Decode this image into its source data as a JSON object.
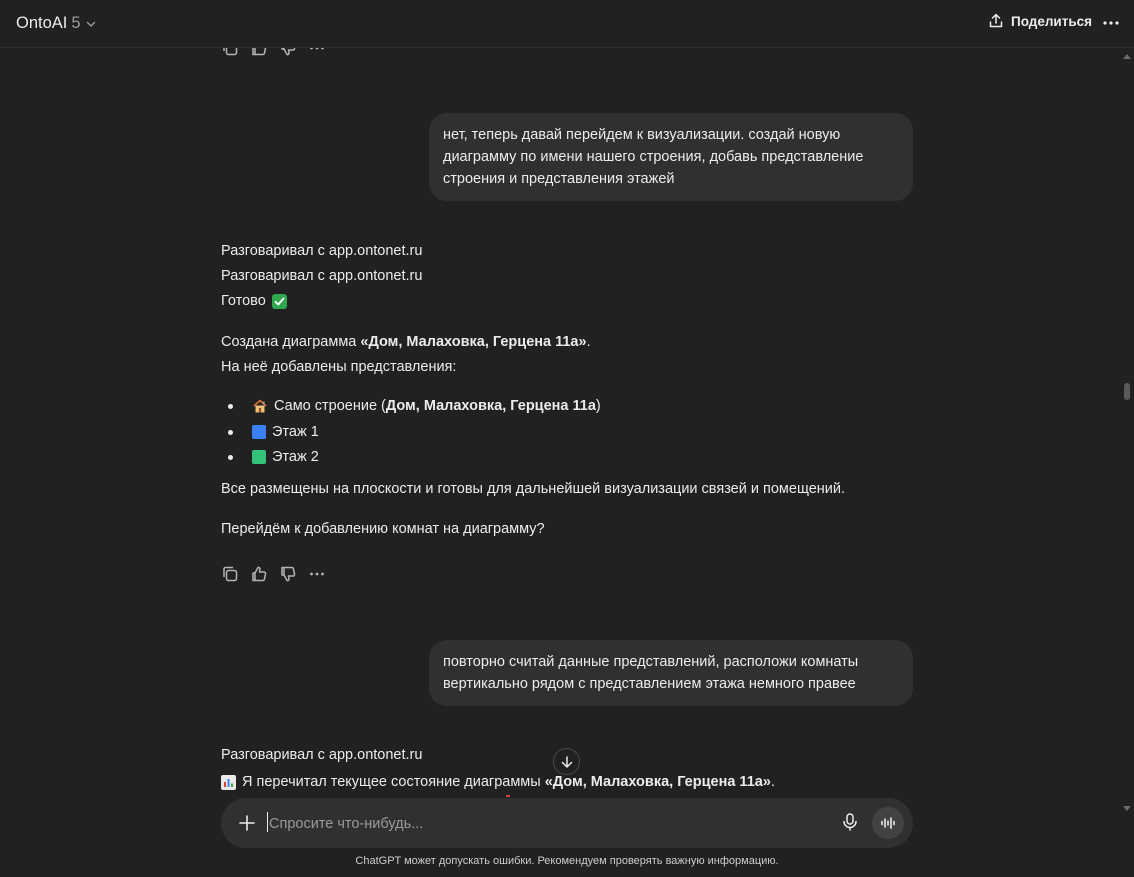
{
  "header": {
    "app_name": "OntoAI",
    "version": "5",
    "share_label": "Поделиться"
  },
  "messages": {
    "user1": "нет, теперь давай перейдем к визуализации. создай новую диаграмму по имени нашего строения, добавь представление строения и представления этажей",
    "assistant1": {
      "tool1": "Разговаривал с app.ontonet.ru",
      "tool2": "Разговаривал с app.ontonet.ru",
      "done": "Готово",
      "created_prefix": "Создана диаграмма ",
      "diagram_name": "«Дом, Малаховка, Герцена 11а»",
      "created_suffix": ".",
      "added": "На неё добавлены представления:",
      "item1_text": "Само строение (",
      "item1_bold": "Дом, Малаховка, Герцена 11а",
      "item1_close": ")",
      "item2": "Этаж 1",
      "item3": "Этаж 2",
      "placed": "Все размещены на плоскости и готовы для дальнейшей визуализации связей и помещений.",
      "question": "Перейдём к добавлению комнат на диаграмму?"
    },
    "user2": "повторно считай данные представлений, расположи комнаты вертикально рядом с представлением этажа немного правее",
    "assistant2": {
      "tool1": "Разговаривал с app.ontonet.ru",
      "reread_prefix": "Я перечитал текущее состояние диаграммы ",
      "diagram_name": "«Дом, Малаховка, Герцена 11а»",
      "reread_suffix": "."
    }
  },
  "composer": {
    "placeholder": "Спросите что-нибудь..."
  },
  "footer": {
    "disclaimer": "ChatGPT может допускать ошибки. Рекомендуем проверять важную информацию."
  },
  "colors": {
    "background": "#212121",
    "bubble": "#303030",
    "floor1": "#3b82f6",
    "floor2": "#34c17a",
    "check": "#2fa84f"
  }
}
